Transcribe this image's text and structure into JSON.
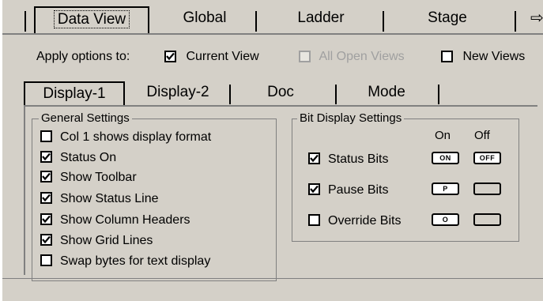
{
  "top_tabs": [
    {
      "label": "Data View",
      "selected": true
    },
    {
      "label": "Global",
      "selected": false
    },
    {
      "label": "Ladder",
      "selected": false
    },
    {
      "label": "Stage",
      "selected": false
    }
  ],
  "apply": {
    "label": "Apply options to:",
    "current_view": {
      "label": "Current View",
      "checked": true
    },
    "all_open_views": {
      "label": "All Open Views",
      "checked": false,
      "disabled": true
    },
    "new_views": {
      "label": "New Views",
      "checked": false
    }
  },
  "inner_tabs": [
    {
      "label": "Display-1",
      "selected": true
    },
    {
      "label": "Display-2",
      "selected": false
    },
    {
      "label": "Doc",
      "selected": false
    },
    {
      "label": "Mode",
      "selected": false
    }
  ],
  "general": {
    "title": "General Settings",
    "options": [
      {
        "label": "Col 1 shows display format",
        "checked": false
      },
      {
        "label": "Status On",
        "checked": true
      },
      {
        "label": "Show Toolbar",
        "checked": true
      },
      {
        "label": "Show Status Line",
        "checked": true
      },
      {
        "label": "Show Column Headers",
        "checked": true
      },
      {
        "label": "Show Grid Lines",
        "checked": true
      },
      {
        "label": "Swap bytes for text display",
        "checked": false
      }
    ]
  },
  "bits": {
    "title": "Bit Display Settings",
    "col_on": "On",
    "col_off": "Off",
    "rows": [
      {
        "label": "Status Bits",
        "checked": true,
        "on_text": "ON",
        "off_text": "OFF"
      },
      {
        "label": "Pause Bits",
        "checked": true,
        "on_text": "P",
        "off_text": ""
      },
      {
        "label": "Override Bits",
        "checked": false,
        "on_text": "O",
        "off_text": ""
      }
    ]
  }
}
